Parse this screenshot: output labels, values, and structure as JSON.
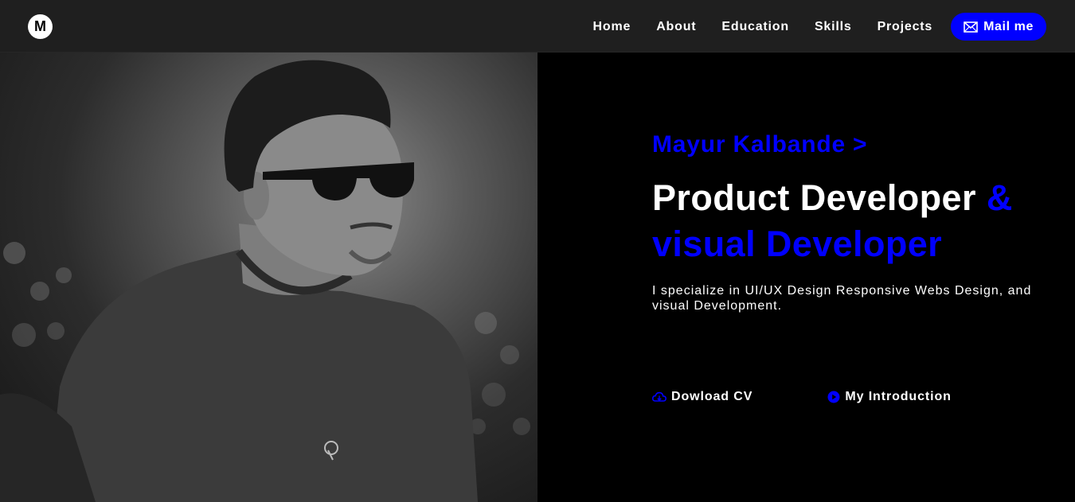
{
  "navbar": {
    "logo_letter": "M",
    "links": [
      "Home",
      "About",
      "Education",
      "Skills",
      "Projects"
    ],
    "mail_label": "Mail me"
  },
  "hero": {
    "name": "Mayur Kalbande >",
    "headline_part1": "Product Developer",
    "headline_part2": "&",
    "headline_part3": "visual Developer",
    "description": "I specialize in UI/UX Design Responsive Webs Design, and visual Development.",
    "download_label": "Dowload CV",
    "intro_label": "My Introduction"
  },
  "colors": {
    "accent": "#0000ff",
    "navbar_bg": "#1f1f1f",
    "page_bg": "#000000",
    "text": "#ffffff"
  },
  "icons": {
    "mail": "envelope-icon",
    "download": "cloud-download-icon",
    "intro": "play-circle-icon"
  }
}
